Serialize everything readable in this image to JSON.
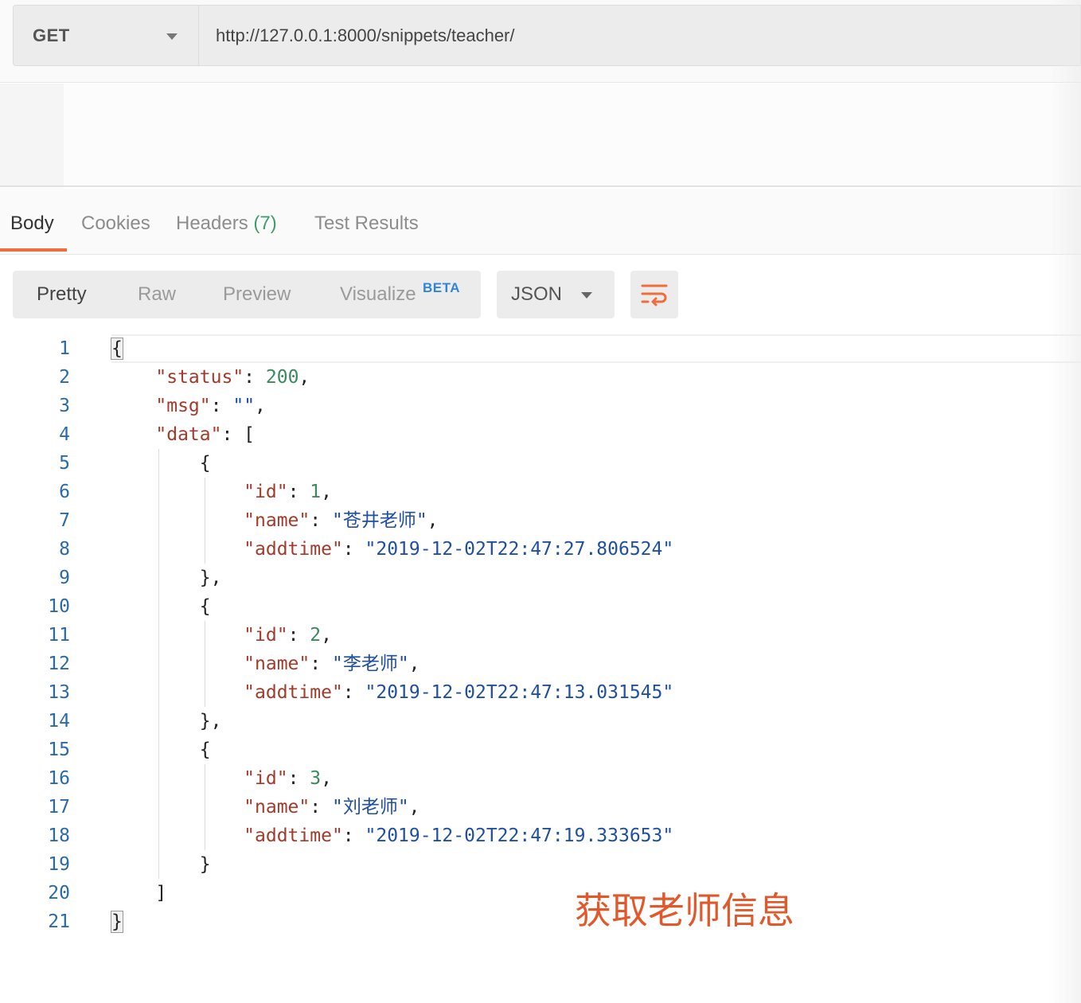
{
  "request": {
    "method": "GET",
    "url": "http://127.0.0.1:8000/snippets/teacher/"
  },
  "response_tabs": {
    "body": "Body",
    "cookies": "Cookies",
    "headers": "Headers",
    "headers_count": "(7)",
    "test_results": "Test Results",
    "active": "Body"
  },
  "view_modes": {
    "pretty": "Pretty",
    "raw": "Raw",
    "preview": "Preview",
    "visualize": "Visualize",
    "visualize_badge": "BETA",
    "active": "Pretty"
  },
  "format": {
    "selected": "JSON"
  },
  "icons": {
    "method_dropdown": "chevron-down-icon",
    "format_dropdown": "chevron-down-icon",
    "wrap": "wrap-lines-icon"
  },
  "colors": {
    "accent": "#f26b3a",
    "key": "#a33a2a",
    "number": "#3b8a5c",
    "string": "#1f4fa0",
    "line_number": "#2a6aa8",
    "badge": "#2f86d6",
    "annotation": "#e2582a"
  },
  "code": {
    "line_numbers": [
      "1",
      "2",
      "3",
      "4",
      "5",
      "6",
      "7",
      "8",
      "9",
      "10",
      "11",
      "12",
      "13",
      "14",
      "15",
      "16",
      "17",
      "18",
      "19",
      "20",
      "21"
    ],
    "status_key": "\"status\"",
    "status_value": "200",
    "msg_key": "\"msg\"",
    "msg_value": "\"\"",
    "data_key": "\"data\"",
    "items": [
      {
        "id_key": "\"id\"",
        "id": "1",
        "name_key": "\"name\"",
        "name": "\"苍井老师\"",
        "addtime_key": "\"addtime\"",
        "addtime": "\"2019-12-02T22:47:27.806524\""
      },
      {
        "id_key": "\"id\"",
        "id": "2",
        "name_key": "\"name\"",
        "name": "\"李老师\"",
        "addtime_key": "\"addtime\"",
        "addtime": "\"2019-12-02T22:47:13.031545\""
      },
      {
        "id_key": "\"id\"",
        "id": "3",
        "name_key": "\"name\"",
        "name": "\"刘老师\"",
        "addtime_key": "\"addtime\"",
        "addtime": "\"2019-12-02T22:47:19.333653\""
      }
    ]
  },
  "annotation": "获取老师信息"
}
